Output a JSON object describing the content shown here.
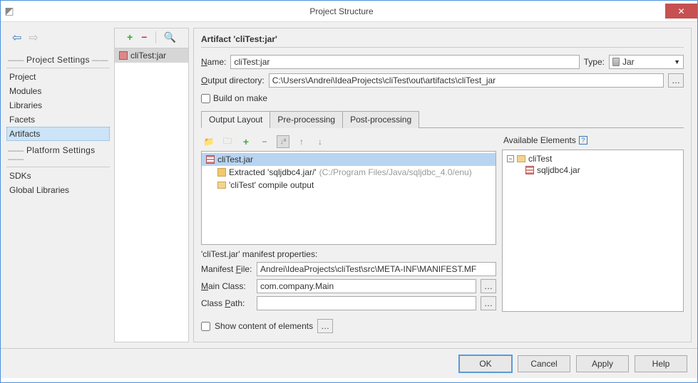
{
  "window": {
    "title": "Project Structure",
    "close_glyph": "✕"
  },
  "nav": {
    "back_arrow": "⬅",
    "fwd_arrow": "➡",
    "project_settings_hdr": "Project Settings",
    "project": "Project",
    "modules": "Modules",
    "libraries": "Libraries",
    "facets": "Facets",
    "artifacts": "Artifacts",
    "platform_settings_hdr": "Platform Settings",
    "sdks": "SDKs",
    "global_libs": "Global Libraries"
  },
  "mid": {
    "plus": "+",
    "minus": "−",
    "search": "🔍",
    "item1": "cliTest:jar"
  },
  "art": {
    "header": "Artifact 'cliTest:jar'",
    "name_label": "Name:",
    "name_value": "cliTest:jar",
    "type_label": "Type:",
    "type_value": "Jar",
    "out_label": "Output directory:",
    "out_value": "C:\\Users\\Andrei\\IdeaProjects\\cliTest\\out\\artifacts\\cliTest_jar",
    "build_on_make": "Build on make",
    "tabs": {
      "layout": "Output Layout",
      "pre": "Pre-processing",
      "post": "Post-processing"
    },
    "tree": {
      "root": "cliTest.jar",
      "extracted_label": "Extracted 'sqljdbc4.jar/' ",
      "extracted_path": "(C:/Program Files/Java/sqljdbc_4.0/enu)",
      "compile": "'cliTest' compile output"
    },
    "manifest": {
      "hdr": "'cliTest.jar' manifest properties:",
      "file_label": "Manifest File:",
      "file_value": "Andrei\\IdeaProjects\\cliTest\\src\\META-INF\\MANIFEST.MF",
      "main_label": "Main Class:",
      "main_value": "com.company.Main",
      "cp_label": "Class Path:",
      "cp_value": ""
    },
    "avail": {
      "hdr": "Available Elements",
      "help": "?",
      "root": "cliTest",
      "lib": "sqljdbc4.jar"
    },
    "show_content": "Show content of elements"
  },
  "footer": {
    "ok": "OK",
    "cancel": "Cancel",
    "apply": "Apply",
    "help": "Help"
  }
}
